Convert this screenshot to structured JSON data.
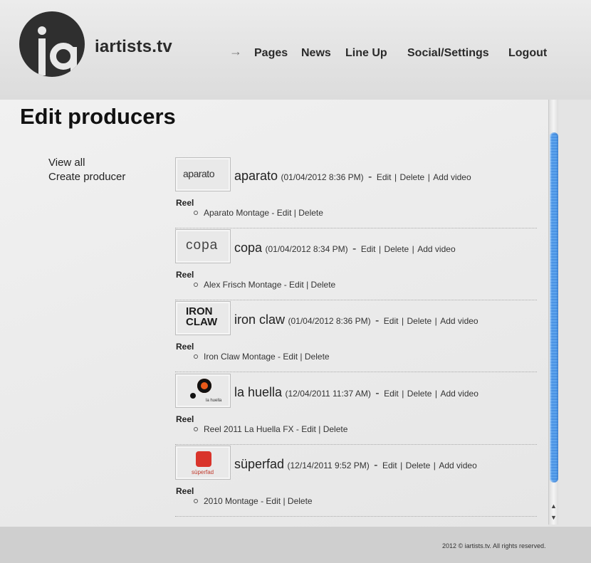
{
  "site": {
    "name": "iartists.tv"
  },
  "nav": {
    "arrow": "→",
    "items": [
      {
        "label": "Pages"
      },
      {
        "label": "News"
      },
      {
        "label": "Line Up"
      },
      {
        "label": "Social/Settings"
      },
      {
        "label": "Logout"
      }
    ]
  },
  "page": {
    "title": "Edit producers"
  },
  "sidebar": {
    "view_all": "View all",
    "create": "Create producer"
  },
  "actions": {
    "edit": "Edit",
    "delete": "Delete",
    "add_video": "Add video",
    "separator": "|",
    "dash": "-"
  },
  "producers": [
    {
      "name": "aparato",
      "date": "(01/04/2012 8:36 PM)",
      "section": "Reel",
      "video": "Aparato Montage - ",
      "thumb_text": "aparato"
    },
    {
      "name": "copa",
      "date": "(01/04/2012 8:34 PM)",
      "section": "Reel",
      "video": "Alex Frisch Montage - ",
      "thumb_text": "copa"
    },
    {
      "name": "iron claw",
      "date": "(01/04/2012 8:36 PM)",
      "section": "Reel",
      "video": "Iron Claw Montage - ",
      "thumb_text": "IRON CLAW"
    },
    {
      "name": "la huella",
      "date": "(12/04/2011 11:37 AM)",
      "section": "Reel",
      "video": "Reel 2011 La Huella FX - ",
      "thumb_text": "la huella"
    },
    {
      "name": "süperfad",
      "date": "(12/14/2011 9:52 PM)",
      "section": "Reel",
      "video": "2010 Montage - ",
      "thumb_text": "süperfad"
    }
  ],
  "footer": {
    "copyright": "2012 © iartists.tv. All rights reserved."
  },
  "colors": {
    "scrollbar_accent": "#4a93e4",
    "footer_bg": "#cfcfcf"
  }
}
